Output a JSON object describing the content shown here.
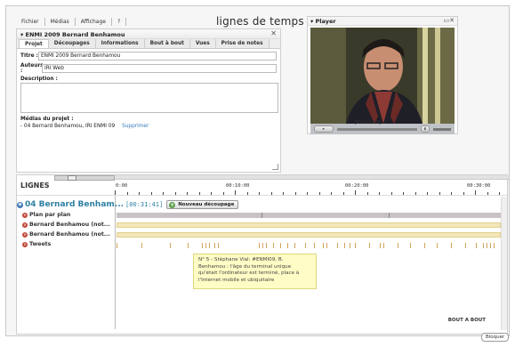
{
  "menu": {
    "items": [
      "Fichier",
      "Médias",
      "Affichage",
      "?"
    ]
  },
  "app_title": "lignes de temps",
  "project": {
    "header": "▾ ENMI 2009 Bernard Benhamou",
    "close": "✕",
    "tabs": [
      "Projet",
      "Découpages",
      "Informations",
      "Bout à bout",
      "Vues",
      "Prise de notes"
    ],
    "active_tab": "Projet",
    "title_label": "Titre :",
    "title_value": "ENMI 2009 Bernard Benhamou",
    "authors_label": "Auteurs :",
    "authors_value": "IRI Web",
    "description_label": "Description :",
    "medias_label": "Médias du projet :",
    "media_item": "- 04 Bernard Benhamou, IRI ENMI 09",
    "delete_label": "Supprimer"
  },
  "player": {
    "header": "▾ Player",
    "window_controls": "▭✕",
    "play_label": "▸",
    "time": "[00:00:00]",
    "vol_label": "◖"
  },
  "timeline": {
    "title": "LIGNES",
    "ruler_labels": [
      "0:00",
      "00:10:00",
      "00:20:00",
      "00:30:00"
    ],
    "media_title": "04 Bernard Benham...",
    "media_time": "[00:31:41]",
    "new_cut_label": "Nouveau découpage",
    "lines": [
      {
        "label": "Plan par plan",
        "style": "grey"
      },
      {
        "label": "Bernard Benhamou (not...",
        "style": "tan"
      },
      {
        "label": "Bernard Benhamou (not...",
        "style": "tan"
      },
      {
        "label": "Tweets",
        "style": "tweets"
      }
    ],
    "tooltip": "N° 5 - Stéphane Vial: #ENMI09, B. Benhamou : l'âge du terminal unique qu'était l'ordinateur est terminé, place à l'Internet mobile et ubiquitaire",
    "bout_a_bout": "BOUT A BOUT",
    "bloquer": "Bloquer"
  },
  "colors": {
    "accent": "#2e7fa3",
    "tooltip_bg": "#fffcc5",
    "track_tan": "#f3e6b9",
    "track_grey": "#c8c2c6"
  }
}
